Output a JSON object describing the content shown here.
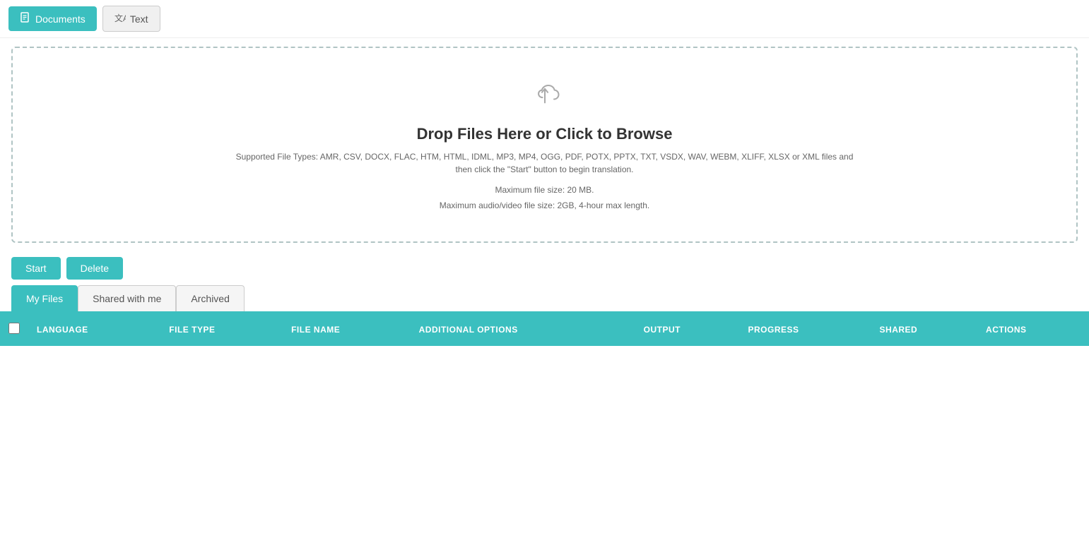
{
  "topbar": {
    "documents_label": "Documents",
    "text_label": "Text"
  },
  "dropzone": {
    "title": "Drop Files Here or Click to Browse",
    "supported_text": "Supported File Types: AMR, CSV, DOCX, FLAC, HTM, HTML, IDML, MP3, MP4, OGG, PDF, POTX, PPTX, TXT, VSDX, WAV, WEBM, XLIFF, XLSX or XML files and then click the \"Start\" button to begin translation.",
    "max_file_size": "Maximum file size: 20 MB.",
    "max_audio_size": "Maximum audio/video file size: 2GB, 4-hour max length."
  },
  "actions": {
    "start_label": "Start",
    "delete_label": "Delete"
  },
  "tabs": [
    {
      "id": "my-files",
      "label": "My Files",
      "active": true
    },
    {
      "id": "shared-with-me",
      "label": "Shared with me",
      "active": false
    },
    {
      "id": "archived",
      "label": "Archived",
      "active": false
    }
  ],
  "table": {
    "columns": [
      {
        "id": "checkbox",
        "label": ""
      },
      {
        "id": "language",
        "label": "LANGUAGE"
      },
      {
        "id": "file-type",
        "label": "FILE TYPE"
      },
      {
        "id": "file-name",
        "label": "FILE NAME"
      },
      {
        "id": "additional-options",
        "label": "ADDITIONAL OPTIONS"
      },
      {
        "id": "output",
        "label": "OUTPUT"
      },
      {
        "id": "progress",
        "label": "PROGRESS"
      },
      {
        "id": "shared",
        "label": "SHARED"
      },
      {
        "id": "actions",
        "label": "ACTIONS"
      }
    ],
    "rows": []
  },
  "colors": {
    "teal": "#3bbfbf",
    "teal_dark": "#2aa0a0"
  }
}
